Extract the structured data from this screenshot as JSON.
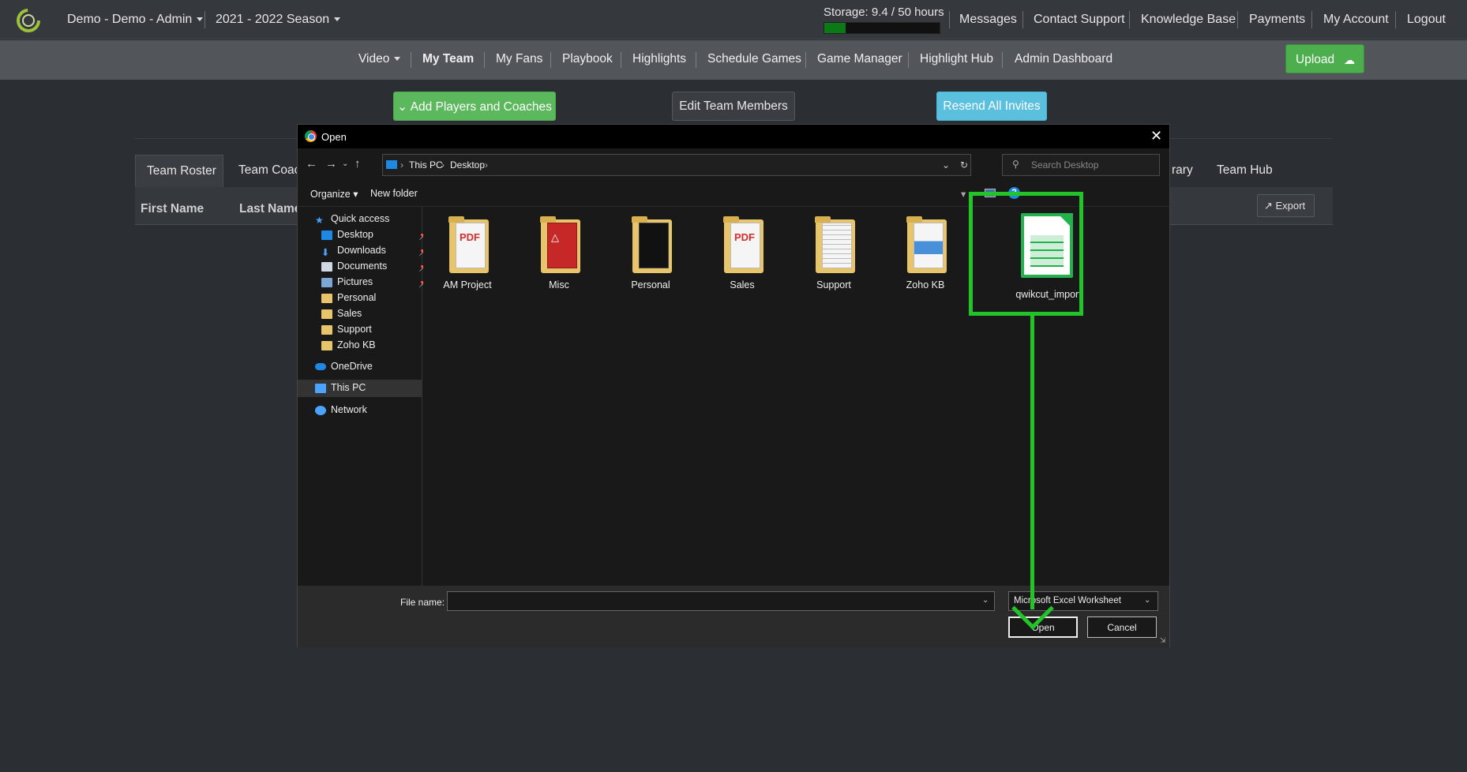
{
  "topbar": {
    "org_menu": "Demo - Demo - Admin",
    "season_menu": "2021 - 2022 Season",
    "storage_label": "Storage: 9.4 / 50 hours",
    "storage_fraction": 0.188,
    "links": [
      "Messages",
      "Contact Support",
      "Knowledge Base",
      "Payments",
      "My Account",
      "Logout"
    ]
  },
  "nav": {
    "items": [
      "Video",
      "My Team",
      "My Fans",
      "Playbook",
      "Highlights",
      "Schedule Games",
      "Game Manager",
      "Highlight Hub",
      "Admin Dashboard"
    ],
    "active": "My Team",
    "upload_label": "Upload"
  },
  "actions": {
    "add": "Add Players and Coaches",
    "edit": "Edit Team Members",
    "resend": "Resend All Invites"
  },
  "team_tabs": {
    "roster": "Team Roster",
    "coach_partial": "Team Coac",
    "library_partial": "rary",
    "hub": "Team Hub"
  },
  "table": {
    "columns": [
      "First Name",
      "Last Name"
    ],
    "export_label": "Export"
  },
  "dialog": {
    "title": "Open",
    "breadcrumbs": [
      "This PC",
      "Desktop"
    ],
    "search_placeholder": "Search Desktop",
    "organize": "Organize",
    "new_folder": "New folder",
    "nav_pane": [
      {
        "label": "Quick access",
        "icon": "star-icon"
      },
      {
        "label": "Desktop",
        "icon": "desktop-icon",
        "pinned": true
      },
      {
        "label": "Downloads",
        "icon": "download-icon",
        "pinned": true
      },
      {
        "label": "Documents",
        "icon": "document-icon",
        "pinned": true
      },
      {
        "label": "Pictures",
        "icon": "picture-icon",
        "pinned": true
      },
      {
        "label": "Personal",
        "icon": "folder-icon"
      },
      {
        "label": "Sales",
        "icon": "folder-icon"
      },
      {
        "label": "Support",
        "icon": "folder-icon"
      },
      {
        "label": "Zoho KB",
        "icon": "folder-icon"
      },
      {
        "label": "OneDrive",
        "icon": "cloud-icon"
      },
      {
        "label": "This PC",
        "icon": "computer-icon"
      },
      {
        "label": "Network",
        "icon": "network-icon"
      }
    ],
    "files": [
      {
        "name": "AM Project",
        "kind": "pdf-folder"
      },
      {
        "name": "Misc",
        "kind": "pdf-folder"
      },
      {
        "name": "Personal",
        "kind": "image-folder"
      },
      {
        "name": "Sales",
        "kind": "pdf-folder"
      },
      {
        "name": "Support",
        "kind": "doc-folder"
      },
      {
        "name": "Zoho KB",
        "kind": "doc-folder"
      },
      {
        "name": "qwikcut_import",
        "kind": "spreadsheet"
      }
    ],
    "file_name_label": "File name:",
    "file_name_value": "",
    "file_type": "Microsoft Excel Worksheet",
    "open_label": "Open",
    "cancel_label": "Cancel"
  },
  "colors": {
    "highlight": "#22c42a",
    "green_button": "#5cb85c",
    "blue_button": "#5bc0de"
  }
}
